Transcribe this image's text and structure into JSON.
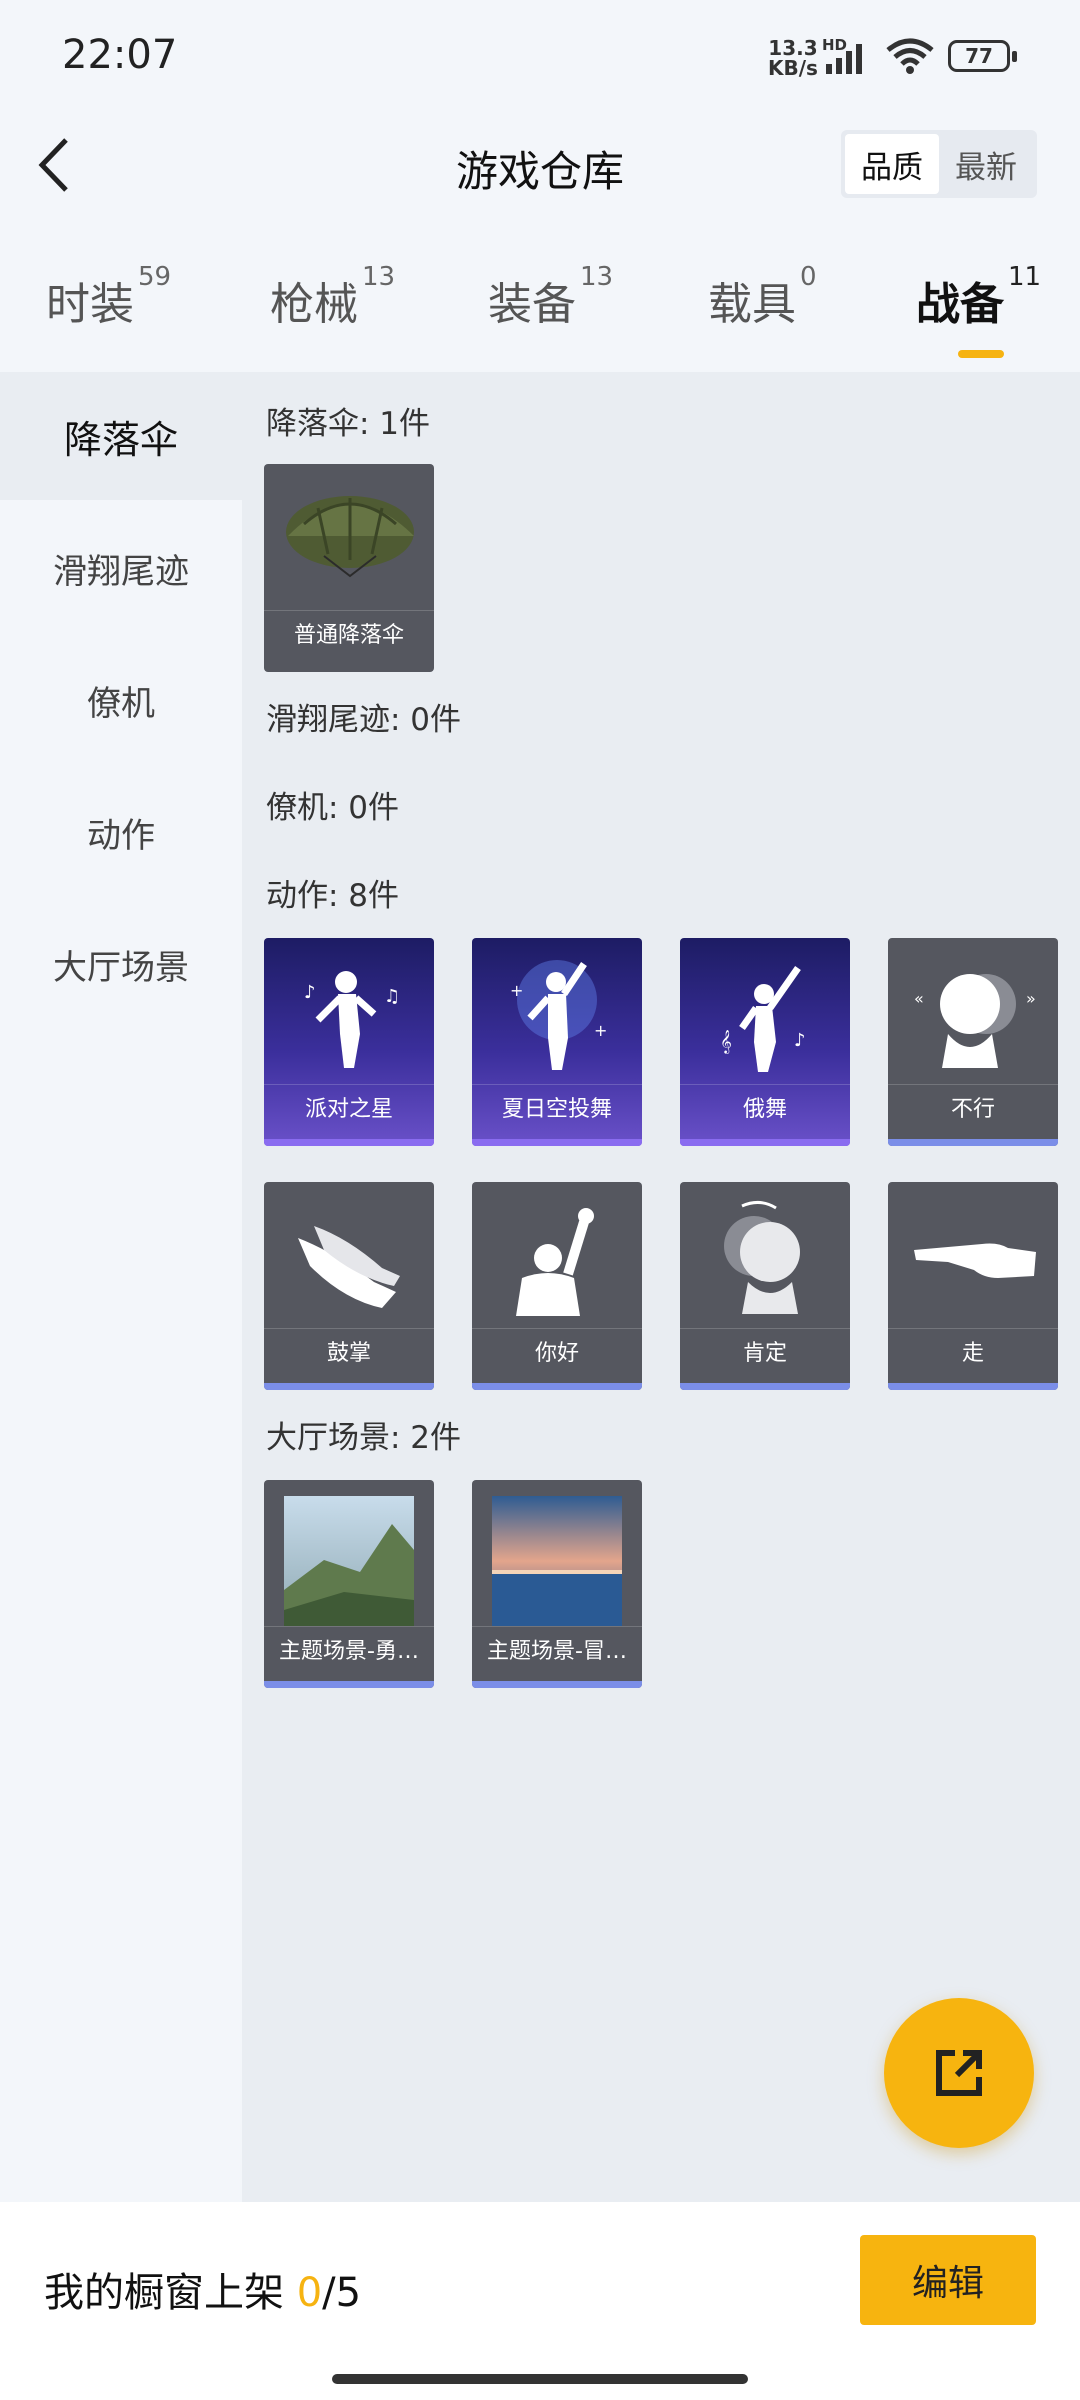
{
  "status": {
    "time": "22:07",
    "speed_value": "13.3",
    "speed_unit": "KB/s",
    "hd": "HD",
    "battery": "77"
  },
  "header": {
    "title": "游戏仓库",
    "sort_options": [
      "品质",
      "最新"
    ]
  },
  "tabs": [
    {
      "label": "时装",
      "count": "59"
    },
    {
      "label": "枪械",
      "count": "13"
    },
    {
      "label": "装备",
      "count": "13"
    },
    {
      "label": "载具",
      "count": "0"
    },
    {
      "label": "战备",
      "count": "11",
      "active": true
    }
  ],
  "sidebar": {
    "items": [
      "降落伞",
      "滑翔尾迹",
      "僚机",
      "动作",
      "大厅场景"
    ]
  },
  "sections": {
    "parachute": {
      "title": "降落伞: 1件",
      "items": [
        "普通降落伞"
      ]
    },
    "glide": {
      "title": "滑翔尾迹: 0件"
    },
    "wingman": {
      "title": "僚机: 0件"
    },
    "emotes": {
      "title": "动作: 8件",
      "items": [
        "派对之星",
        "夏日空投舞",
        "俄舞",
        "不行",
        "鼓掌",
        "你好",
        "肯定",
        "走"
      ]
    },
    "lobby": {
      "title": "大厅场景: 2件",
      "items": [
        "主题场景-勇…",
        "主题场景-冒…"
      ]
    }
  },
  "bottom": {
    "label": "我的橱窗上架 ",
    "current": "0",
    "total": "/5",
    "edit_label": "编辑"
  },
  "colors": {
    "accent": "#f7b40f",
    "rarity_blue": "#7b8ee8",
    "rarity_purple": "#8a6cf0"
  }
}
